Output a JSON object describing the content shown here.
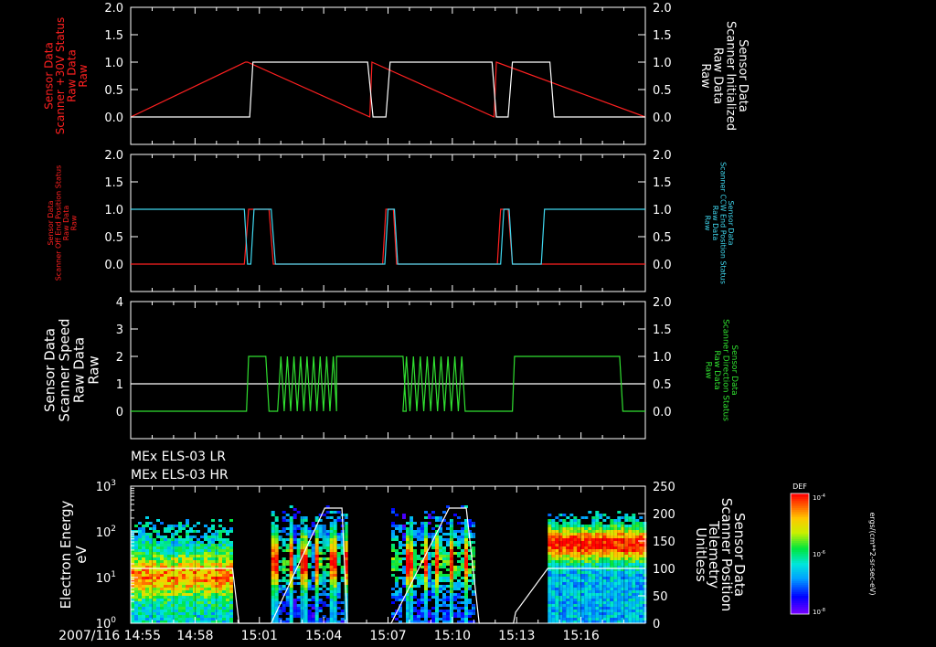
{
  "colors": {
    "background": "#000000",
    "axes": "#ffffff",
    "red": "#ff2020",
    "cyan": "#40d8f0",
    "green": "#30e030",
    "white": "#ffffff"
  },
  "chart_data": [
    {
      "type": "line",
      "panel": 1,
      "left_label_lines": [
        "Sensor Data",
        "Scanner +30V Status",
        "Raw Data",
        "Raw"
      ],
      "right_label_lines": [
        "Sensor Data",
        "Scanner Initialized",
        "Raw Data",
        "Raw"
      ],
      "left_ticks": [
        "0.0",
        "0.5",
        "1.0",
        "1.5",
        "2.0"
      ],
      "right_ticks": [
        "0.0",
        "0.5",
        "1.0",
        "1.5",
        "2.0"
      ],
      "ylim": [
        -0.5,
        2.0
      ],
      "xlim_minutes": [
        0,
        24
      ],
      "series": [
        {
          "color_key": "red",
          "x": [
            0,
            5.35,
            5.45,
            11.15,
            11.25,
            16.95,
            17.05,
            24
          ],
          "y": [
            0,
            1,
            1,
            0,
            1,
            0,
            1,
            0
          ]
        },
        {
          "color_key": "white",
          "x": [
            0,
            5.55,
            5.7,
            11.05,
            11.3,
            11.9,
            12.1,
            16.85,
            17.05,
            17.6,
            17.8,
            19.55,
            19.75,
            24
          ],
          "y": [
            0,
            0,
            1,
            1,
            0,
            0,
            1,
            1,
            0,
            0,
            1,
            1,
            0,
            0
          ]
        }
      ]
    },
    {
      "type": "line",
      "panel": 2,
      "left_label_lines": [
        "Sensor Data",
        "Scanner Off End Position Status",
        "Raw Data",
        "Raw"
      ],
      "right_label_lines": [
        "Sensor Data",
        "Scanner CCW End Position Status",
        "Raw Data",
        "Raw"
      ],
      "left_ticks": [
        "0.0",
        "0.5",
        "1.0",
        "1.5",
        "2.0"
      ],
      "right_ticks": [
        "0.0",
        "0.5",
        "1.0",
        "1.5",
        "2.0"
      ],
      "ylim": [
        -0.5,
        2.0
      ],
      "xlim_minutes": [
        0,
        24
      ],
      "series": [
        {
          "color_key": "red",
          "x": [
            0,
            5.3,
            5.5,
            6.45,
            6.65,
            11.75,
            11.9,
            12.25,
            12.4,
            17.1,
            17.25,
            17.6,
            17.8,
            24
          ],
          "y": [
            0,
            0,
            1,
            1,
            0,
            0,
            1,
            1,
            0,
            0,
            1,
            1,
            0,
            0
          ]
        },
        {
          "color_key": "cyan",
          "x": [
            0,
            5.3,
            5.45,
            5.6,
            5.75,
            6.55,
            6.75,
            11.85,
            12.0,
            12.3,
            12.45,
            17.25,
            17.4,
            17.65,
            17.8,
            19.15,
            19.3,
            24
          ],
          "y": [
            1,
            1,
            0,
            0,
            1,
            1,
            0,
            0,
            1,
            1,
            0,
            0,
            1,
            1,
            0,
            0,
            1,
            1
          ]
        }
      ]
    },
    {
      "type": "line",
      "panel": 3,
      "left_label_lines": [
        "Sensor Data",
        "Scanner Speed",
        "Raw Data",
        "Raw"
      ],
      "right_label_lines": [
        "Sensor Data",
        "Scanner Direction Status",
        "Raw Data",
        "Raw"
      ],
      "left_ticks": [
        "0",
        "1",
        "2",
        "3",
        "4"
      ],
      "right_ticks": [
        "0.0",
        "0.5",
        "1.0",
        "1.5",
        "2.0"
      ],
      "ylim_left": [
        -1,
        4
      ],
      "ylim_right": [
        -0.5,
        2.0
      ],
      "xlim_minutes": [
        0,
        24
      ],
      "series": [
        {
          "color_key": "white",
          "axis": "left",
          "x": [
            0,
            24
          ],
          "y": [
            1,
            1
          ]
        },
        {
          "color_key": "green",
          "axis": "right",
          "on_intervals": [
            [
              5.5,
              6.3
            ],
            [
              9.6,
              12.7
            ],
            [
              17.9,
              22.8
            ]
          ],
          "oscillation_intervals": [
            [
              6.85,
              9.6
            ],
            [
              12.7,
              15.6
            ]
          ],
          "oscillation_cycles": [
            9,
            9
          ]
        }
      ]
    },
    {
      "type": "heatmap",
      "panel": 4,
      "title_lines": [
        "MEx ELS-03 LR",
        "MEx ELS-03 HR"
      ],
      "ylabel_lines": [
        "Electron Energy",
        "eV"
      ],
      "right_label_lines": [
        "Sensor Data",
        "Scanner Position",
        "Telemetry",
        "Unitless"
      ],
      "ylim_log": [
        0,
        3
      ],
      "y_ticks": [
        {
          "base": "10",
          "exp": "0"
        },
        {
          "base": "10",
          "exp": "1"
        },
        {
          "base": "10",
          "exp": "2"
        },
        {
          "base": "10",
          "exp": "3"
        }
      ],
      "right_ticks": [
        "0",
        "50",
        "100",
        "150",
        "200",
        "250"
      ],
      "ylim_right": [
        0,
        250
      ],
      "data_intervals": [
        [
          0,
          4.75
        ],
        [
          6.55,
          10.1
        ],
        [
          12.15,
          15.95
        ],
        [
          19.45,
          24
        ]
      ],
      "scanner_position": {
        "x": [
          0,
          4.75,
          5.05,
          6.55,
          9.05,
          9.85,
          10.1,
          12.15,
          14.85,
          15.65,
          16.25,
          17.85,
          17.95,
          19.45,
          24
        ],
        "y": [
          100,
          100,
          0,
          0,
          210,
          210,
          0,
          0,
          210,
          210,
          0,
          0,
          20,
          100,
          100
        ]
      },
      "colorbar_label": "DEF",
      "colorbar_ticks": [
        {
          "base": "10",
          "exp": "-4"
        },
        {
          "base": "10",
          "exp": "-6"
        },
        {
          "base": "10",
          "exp": "-8"
        }
      ],
      "colorbar_units": "ergs/(cm**2-sr-sec-eV)"
    }
  ],
  "time_axis": {
    "range_minutes": [
      0,
      24
    ],
    "ticks": [
      {
        "minute": 0,
        "label": "2007/116 14:55"
      },
      {
        "minute": 3,
        "label": "14:58"
      },
      {
        "minute": 6,
        "label": "15:01"
      },
      {
        "minute": 9,
        "label": "15:04"
      },
      {
        "minute": 12,
        "label": "15:07"
      },
      {
        "minute": 15,
        "label": "15:10"
      },
      {
        "minute": 18,
        "label": "15:13"
      },
      {
        "minute": 21,
        "label": "15:16"
      }
    ]
  }
}
